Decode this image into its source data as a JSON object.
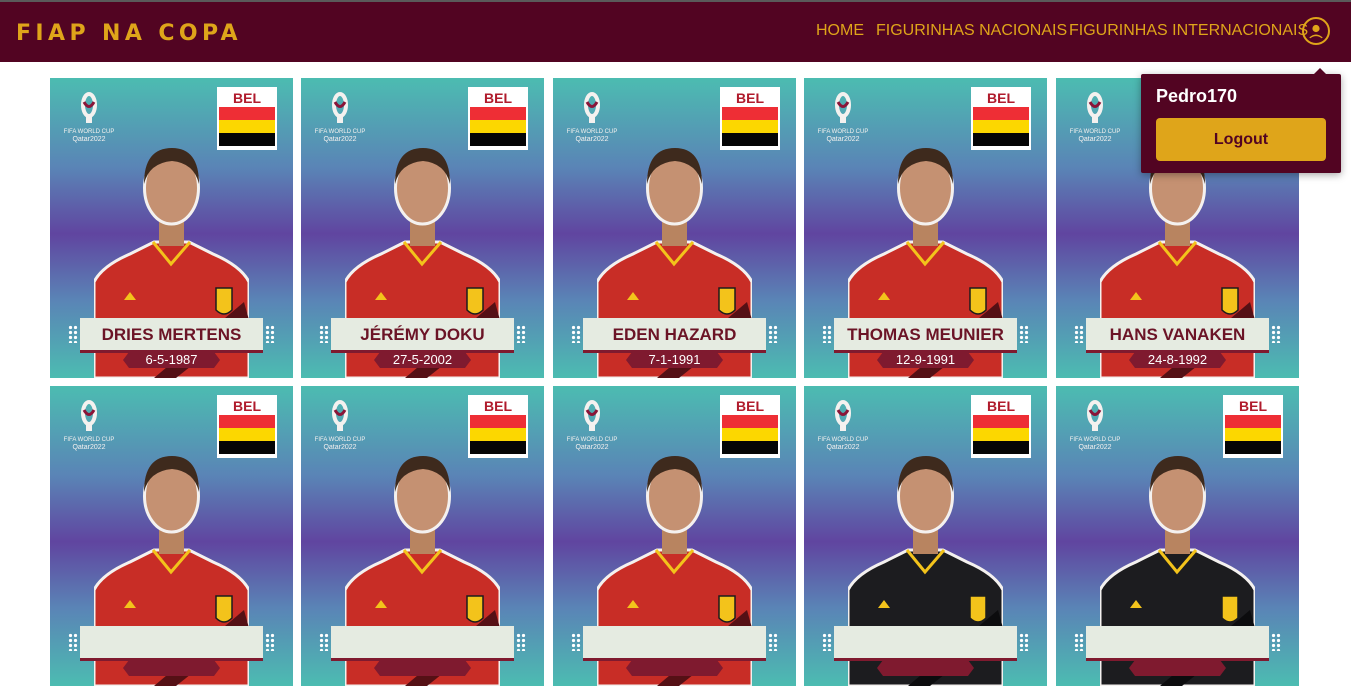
{
  "app": {
    "brand": "FIAP NA COPA"
  },
  "nav": {
    "links": [
      "HOME",
      "FIGURINHAS NACIONAIS",
      "FIGURINHAS INTERNACIONAIS"
    ]
  },
  "user_menu": {
    "username": "Pedro170",
    "logout_label": "Logout"
  },
  "colors": {
    "navbar": "#520422",
    "accent": "#dfa51a",
    "card_teal": "#4cbcb1",
    "card_purple": "#6045a0",
    "banner_text": "#6b1426",
    "date_band": "#7f1a2f"
  },
  "cards": [
    {
      "code": "BEL",
      "name": "DRIES MERTENS",
      "date": "6-5-1987",
      "jersey": "red"
    },
    {
      "code": "BEL",
      "name": "JÉRÉMY DOKU",
      "date": "27-5-2002",
      "jersey": "red"
    },
    {
      "code": "BEL",
      "name": "EDEN HAZARD",
      "date": "7-1-1991",
      "jersey": "red"
    },
    {
      "code": "BEL",
      "name": "THOMAS MEUNIER",
      "date": "12-9-1991",
      "jersey": "red"
    },
    {
      "code": "BEL",
      "name": "HANS VANAKEN",
      "date": "24-8-1992",
      "jersey": "red"
    },
    {
      "code": "BEL",
      "name": "",
      "date": "",
      "jersey": "red"
    },
    {
      "code": "BEL",
      "name": "",
      "date": "",
      "jersey": "red"
    },
    {
      "code": "BEL",
      "name": "",
      "date": "",
      "jersey": "red"
    },
    {
      "code": "BEL",
      "name": "",
      "date": "",
      "jersey": "black"
    },
    {
      "code": "BEL",
      "name": "",
      "date": "",
      "jersey": "black"
    }
  ]
}
